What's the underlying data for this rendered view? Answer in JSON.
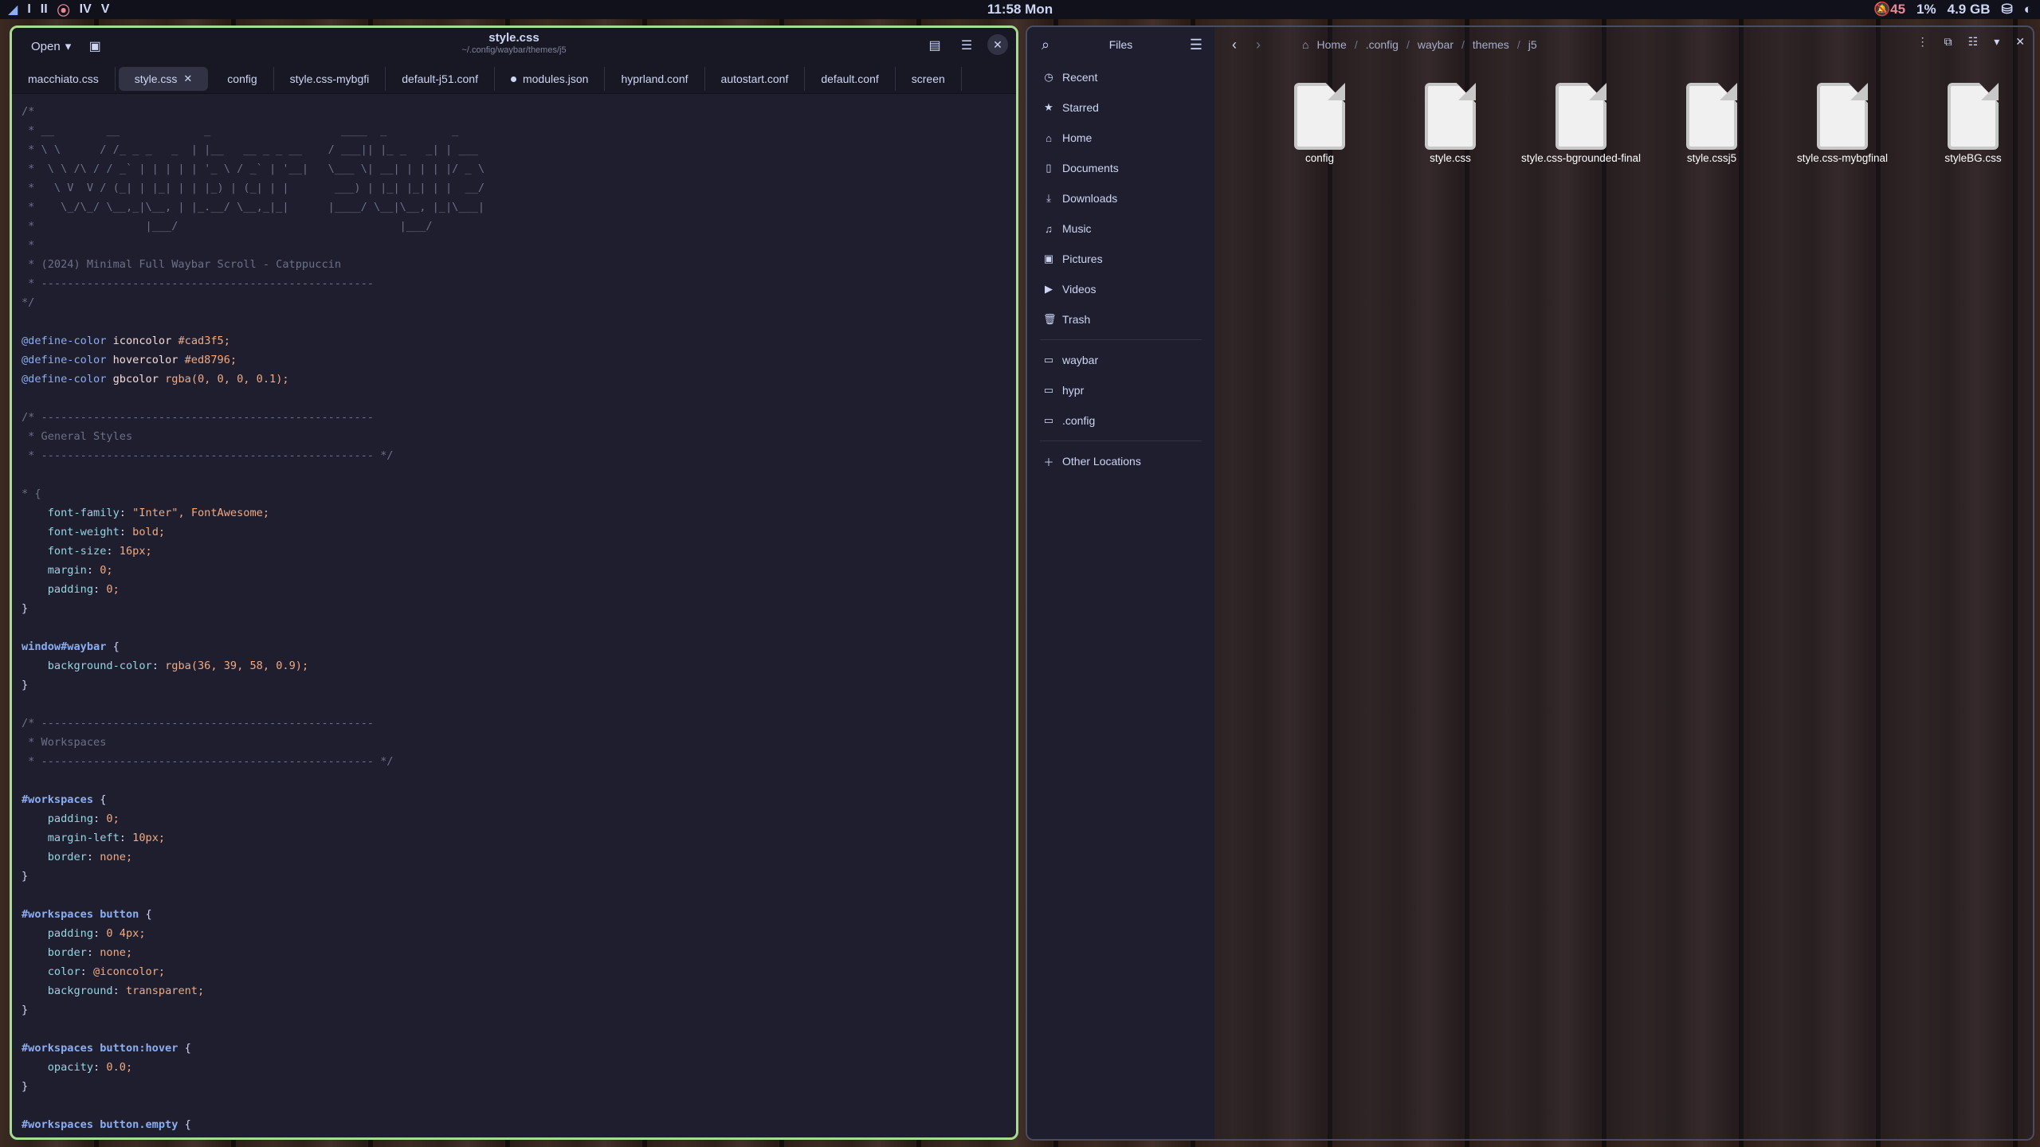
{
  "topbar": {
    "workspaces": [
      "I",
      "II",
      "IV",
      "V"
    ],
    "clock": "11:58 Mon",
    "status": {
      "notifications": "45",
      "cpu": "1%",
      "memory": "4.9 GB"
    }
  },
  "editor": {
    "open_label": "Open",
    "title": "style.css",
    "path": "~/.config/waybar/themes/j5",
    "tabs": [
      {
        "label": "macchiato.css"
      },
      {
        "label": "style.css",
        "active": true
      },
      {
        "label": "config"
      },
      {
        "label": "style.css-mybgfi"
      },
      {
        "label": "default-j51.conf"
      },
      {
        "label": "modules.json",
        "modified": true
      },
      {
        "label": "hyprland.conf"
      },
      {
        "label": "autostart.conf"
      },
      {
        "label": "default.conf"
      },
      {
        "label": "screen"
      }
    ],
    "code_lines": [
      "/*",
      " * __        __             _                    ____  _          _",
      " * \\ \\      / /_ _ _   _  | |__   __ _ _ __    / ___|| |_ _   _| | ___",
      " *  \\ \\ /\\ / / _` | | | | | '_ \\ / _` | '__|   \\___ \\| __| | | | |/ _ \\",
      " *   \\ V  V / (_| | |_| | | |_) | (_| | |       ___) | |_| |_| | |  __/",
      " *    \\_/\\_/ \\__,_|\\__, | |_.__/ \\__,_|_|      |____/ \\__|\\__, |_|\\___|",
      " *                 |___/                                  |___/",
      " *",
      " * (2024) Minimal Full Waybar Scroll - Catppuccin",
      " * ---------------------------------------------------",
      "*/",
      "",
      "@define-color iconcolor #cad3f5;",
      "@define-color hovercolor #ed8796;",
      "@define-color gbcolor rgba(0, 0, 0, 0.1);",
      "",
      "/* ---------------------------------------------------",
      " * General Styles",
      " * --------------------------------------------------- */",
      "",
      "* {",
      "    font-family: \"Inter\", FontAwesome;",
      "    font-weight: bold;",
      "    font-size: 16px;",
      "    margin: 0;",
      "    padding: 0;",
      "}",
      "",
      "window#waybar {",
      "    background-color: rgba(36, 39, 58, 0.9);",
      "}",
      "",
      "/* ---------------------------------------------------",
      " * Workspaces",
      " * --------------------------------------------------- */",
      "",
      "#workspaces {",
      "    padding: 0;",
      "    margin-left: 10px;",
      "    border: none;",
      "}",
      "",
      "#workspaces button {",
      "    padding: 0 4px;",
      "    border: none;",
      "    color: @iconcolor;",
      "    background: transparent;",
      "}",
      "",
      "#workspaces button:hover {",
      "    opacity: 0.0;",
      "}",
      "",
      "#workspaces button.empty {"
    ]
  },
  "files": {
    "title": "Files",
    "sidebar": [
      {
        "label": "Recent",
        "icon": "clock-icon"
      },
      {
        "label": "Starred",
        "icon": "star-icon"
      },
      {
        "label": "Home",
        "icon": "home-icon"
      },
      {
        "label": "Documents",
        "icon": "document-icon"
      },
      {
        "label": "Downloads",
        "icon": "download-icon"
      },
      {
        "label": "Music",
        "icon": "music-icon"
      },
      {
        "label": "Pictures",
        "icon": "picture-icon"
      },
      {
        "label": "Videos",
        "icon": "video-icon"
      },
      {
        "label": "Trash",
        "icon": "trash-icon"
      }
    ],
    "bookmarks": [
      {
        "label": "waybar",
        "icon": "folder-icon"
      },
      {
        "label": "hypr",
        "icon": "folder-icon"
      },
      {
        "label": ".config",
        "icon": "folder-icon"
      }
    ],
    "other_locations": "Other Locations",
    "breadcrumb": [
      "Home",
      ".config",
      "waybar",
      "themes",
      "j5"
    ],
    "items": [
      {
        "name": "config"
      },
      {
        "name": "style.css"
      },
      {
        "name": "style.css-bgrounded-final"
      },
      {
        "name": "style.cssj5"
      },
      {
        "name": "style.css-mybgfinal"
      },
      {
        "name": "styleBG.css"
      }
    ]
  }
}
